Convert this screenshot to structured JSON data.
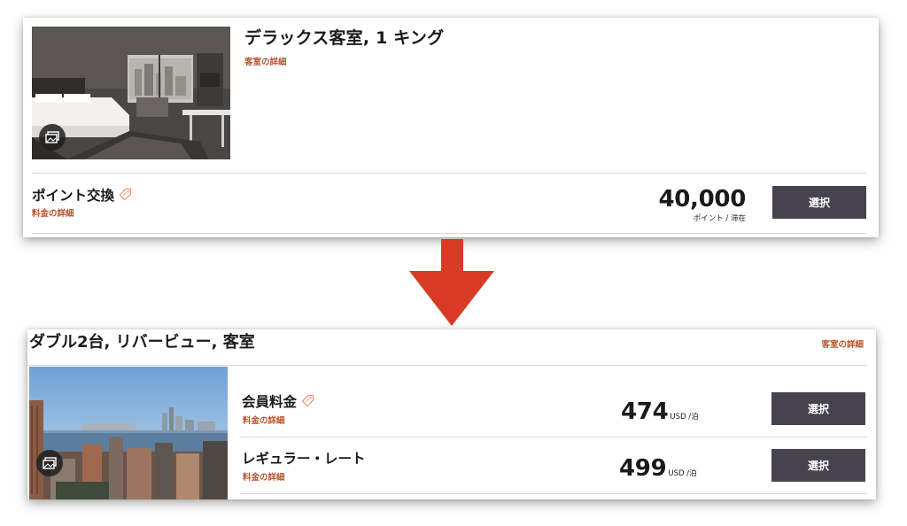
{
  "top_card": {
    "room_title": "デラックス客室, 1 キング",
    "room_details_link": "客室の詳細",
    "rate": {
      "name": "ポイント交換",
      "details_link": "料金の詳細",
      "price": "40,000",
      "price_unit": "ポイント / 滞在",
      "select_label": "選択"
    }
  },
  "bottom_card": {
    "room_title": "ダブル2台, リバービュー, 客室",
    "room_details_link": "客室の詳細",
    "rates": [
      {
        "name": "会員料金",
        "details_link": "料金の詳細",
        "price": "474",
        "price_unit": "USD /泊",
        "select_label": "選択"
      },
      {
        "name": "レギュラー・レート",
        "details_link": "料金の詳細",
        "price": "499",
        "price_unit": "USD /泊",
        "select_label": "選択"
      }
    ]
  },
  "colors": {
    "accent_link": "#b5532a",
    "button_bg": "#46434f",
    "arrow": "#d93a24"
  },
  "icons": [
    "gallery-icon",
    "tag-icon",
    "down-arrow-icon"
  ]
}
